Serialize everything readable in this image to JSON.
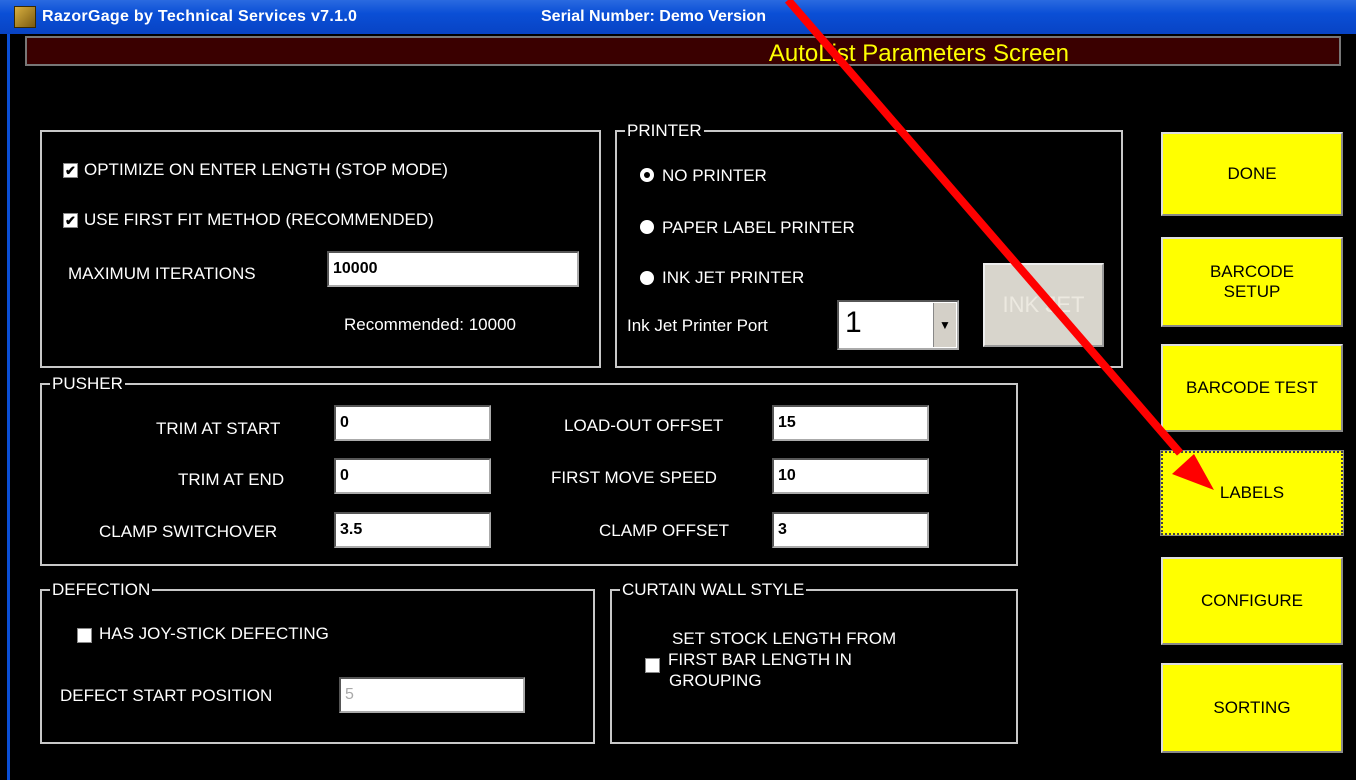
{
  "window": {
    "title": "RazorGage  by  Technical Services   v7.1.0",
    "serial": "Serial Number: Demo Version"
  },
  "header": {
    "title": "AutoList Parameters Screen"
  },
  "optimize": {
    "optimize_label": "OPTIMIZE ON ENTER LENGTH (STOP MODE)",
    "first_fit_label": "USE FIRST FIT METHOD (RECOMMENDED)",
    "max_iter_label": "MAXIMUM ITERATIONS",
    "max_iter_value": "10000",
    "recommended_text": "Recommended: 10000"
  },
  "printer": {
    "legend": "PRINTER",
    "no_printer": "NO PRINTER",
    "paper_label": "PAPER LABEL PRINTER",
    "ink_jet": "INK JET PRINTER",
    "port_label": "Ink Jet Printer Port",
    "port_value": "1",
    "ink_jet_button": "INK JET"
  },
  "pusher": {
    "legend": "PUSHER",
    "trim_start_label": "TRIM AT START",
    "trim_start_value": "0",
    "trim_end_label": "TRIM AT END",
    "trim_end_value": "0",
    "clamp_switch_label": "CLAMP SWITCHOVER",
    "clamp_switch_value": "3.5",
    "load_out_label": "LOAD-OUT OFFSET",
    "load_out_value": "15",
    "first_move_label": "FIRST MOVE SPEED",
    "first_move_value": "10",
    "clamp_offset_label": "CLAMP OFFSET",
    "clamp_offset_value": "3"
  },
  "defection": {
    "legend": "DEFECTION",
    "joystick_label": "HAS JOY-STICK DEFECTING",
    "start_label": "DEFECT START POSITION",
    "start_value": "5"
  },
  "curtain": {
    "legend": "CURTAIN WALL STYLE",
    "line1": "SET STOCK LENGTH FROM",
    "line2": "FIRST BAR LENGTH IN",
    "line3": "GROUPING"
  },
  "buttons": {
    "done": "DONE",
    "barcode_setup_1": "BARCODE",
    "barcode_setup_2": "SETUP",
    "barcode_test": "BARCODE TEST",
    "labels": "LABELS",
    "configure": "CONFIGURE",
    "sorting": "SORTING"
  },
  "colors": {
    "accent": "#ffff00",
    "arrow": "#ff0000",
    "titlebar": "#0a4fd6"
  }
}
